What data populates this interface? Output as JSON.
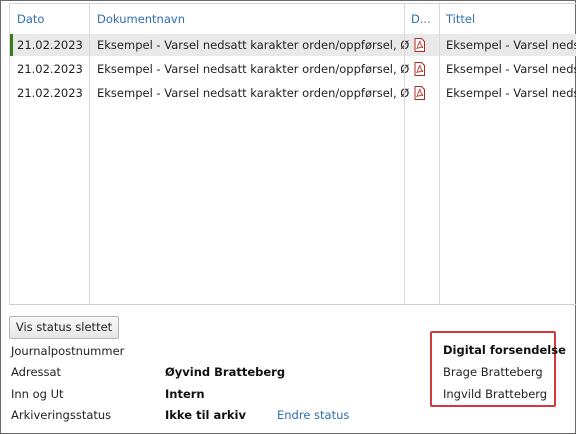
{
  "table": {
    "columns": [
      "Dato",
      "Dokumentnavn",
      "D...",
      "Tittel"
    ],
    "rows": [
      {
        "date": "21.02.2023",
        "name": "Eksempel - Varsel nedsatt karakter orden/oppførsel, Øyv...",
        "title": "Eksempel - Varsel nedsatt"
      },
      {
        "date": "21.02.2023",
        "name": "Eksempel - Varsel nedsatt karakter orden/oppførsel, Øyv...",
        "title": "Eksempel - Varsel nedsatt"
      },
      {
        "date": "21.02.2023",
        "name": "Eksempel - Varsel nedsatt karakter orden/oppførsel, Øyv...",
        "title": "Eksempel - Varsel nedsatt"
      }
    ],
    "doc_icon": "pdf-icon",
    "accent_color": "#3c7a1e",
    "header_color": "#2f6fb3"
  },
  "buttons": {
    "show_deleted": "Vis status slettet"
  },
  "details": {
    "journal_label": "Journalpostnummer",
    "addressee_label": "Adressat",
    "addressee_value": "Øyvind Bratteberg",
    "direction_label": "Inn og Ut",
    "direction_value": "Intern",
    "archive_label": "Arkiveringsstatus",
    "archive_value": "Ikke til arkiv",
    "change_status_link": "Endre status"
  },
  "digital": {
    "title": "Digital forsendelse",
    "recipients": [
      "Brage Bratteberg",
      "Ingvild Bratteberg"
    ],
    "highlight_color": "#d13a3a"
  }
}
